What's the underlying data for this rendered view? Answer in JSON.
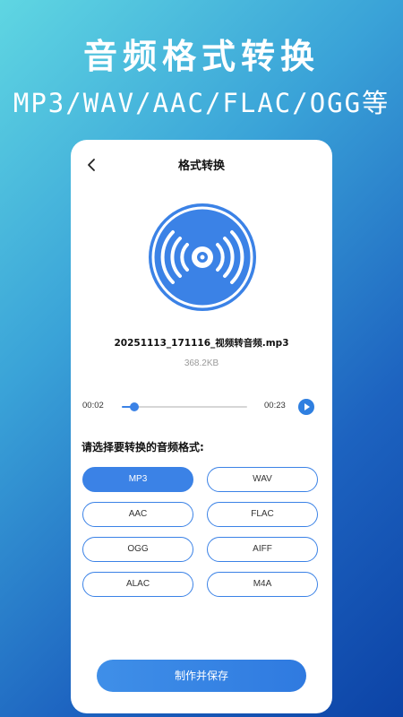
{
  "promo": {
    "headline": "音频格式转换",
    "subline": "MP3/WAV/AAC/FLAC/OGG等"
  },
  "screen": {
    "title": "格式转换",
    "back_icon": "chevron-left-icon",
    "cover_icon": "vinyl-disc-icon",
    "file": {
      "name": "20251113_171116_视频转音频.mp3",
      "size": "368.2KB"
    },
    "player": {
      "current_time": "00:02",
      "total_time": "00:23",
      "progress": 0.1,
      "play_icon": "play-icon"
    },
    "prompt": "请选择要转换的音频格式:",
    "formats": [
      {
        "label": "MP3",
        "selected": true
      },
      {
        "label": "WAV",
        "selected": false
      },
      {
        "label": "AAC",
        "selected": false
      },
      {
        "label": "FLAC",
        "selected": false
      },
      {
        "label": "OGG",
        "selected": false
      },
      {
        "label": "AIFF",
        "selected": false
      },
      {
        "label": "ALAC",
        "selected": false
      },
      {
        "label": "M4A",
        "selected": false
      }
    ],
    "save_label": "制作并保存"
  },
  "colors": {
    "accent": "#3b82e6",
    "background_start": "#5fd6e2",
    "background_end": "#0c43a6"
  }
}
